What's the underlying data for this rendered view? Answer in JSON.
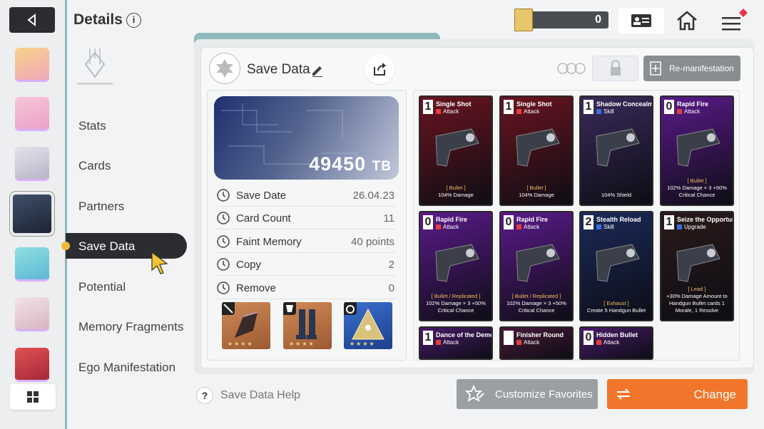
{
  "header": {
    "title": "Details",
    "currency_value": "0"
  },
  "nav": {
    "items": [
      "Stats",
      "Cards",
      "Partners",
      "Save Data",
      "Potential",
      "Memory Fragments",
      "Ego Manifestation"
    ],
    "active": "Save Data"
  },
  "panel": {
    "save_title": "Save Data",
    "reman_label": "Re-manifestation"
  },
  "summary": {
    "tb_value": "49450",
    "tb_unit": "TB"
  },
  "stats": [
    {
      "label": "Save Date",
      "value": "26.04.23",
      "icon": "clock-icon"
    },
    {
      "label": "Card Count",
      "value": "11",
      "icon": "card-icon"
    },
    {
      "label": "Faint Memory",
      "value": "40 points",
      "icon": "brain-icon"
    },
    {
      "label": "Copy",
      "value": "2",
      "icon": "copy-icon"
    },
    {
      "label": "Remove",
      "value": "0",
      "icon": "remove-icon"
    }
  ],
  "equipment": [
    {
      "slot": "weapon",
      "icon": "sword-icon",
      "color": "#c57a45"
    },
    {
      "slot": "armor",
      "icon": "armor-icon",
      "color": "#c57a45"
    },
    {
      "slot": "accessory",
      "icon": "ring-icon",
      "color": "#2e5bb0"
    }
  ],
  "cards": [
    {
      "cost": "1",
      "name": "Single Shot",
      "type": "Attack",
      "tag": "[ Bullet ]",
      "desc": "104% Damage",
      "bg": "#6a1420"
    },
    {
      "cost": "1",
      "name": "Single Shot",
      "type": "Attack",
      "tag": "[ Bullet ]",
      "desc": "104% Damage",
      "bg": "#6a1420"
    },
    {
      "cost": "1",
      "name": "Shadow Concealment",
      "type": "Skill",
      "tag": "",
      "desc": "104% Shield",
      "bg": "#3a2a5a"
    },
    {
      "cost": "0",
      "name": "Rapid Fire",
      "type": "Attack",
      "tag": "[ Bullet ]",
      "desc": "102% Damage × 3 +50% Critical Chance",
      "bg": "#5a1a8a"
    },
    {
      "cost": "0",
      "name": "Rapid Fire",
      "type": "Attack",
      "tag": "[ Bullet / Replicated ]",
      "desc": "102% Damage × 3 +50% Critical Chance",
      "bg": "#5a1a8a"
    },
    {
      "cost": "0",
      "name": "Rapid Fire",
      "type": "Attack",
      "tag": "[ Bullet / Replicated ]",
      "desc": "102% Damage × 3 +50% Critical Chance",
      "bg": "#5a1a8a"
    },
    {
      "cost": "2",
      "name": "Stealth Reload",
      "type": "Skill",
      "tag": "[ Exhaust ]",
      "desc": "Create 5 Handgun Bullet",
      "bg": "#1a2a5a"
    },
    {
      "cost": "1",
      "name": "Seize the Opportunity",
      "type": "Upgrade",
      "tag": "[ Lead ]",
      "desc": "+30% Damage Amount to Handgun Bullet cards 1 Morale, 1 Resolve",
      "bg": "#2a1a1a"
    },
    {
      "cost": "1",
      "name": "Dance of the Demon",
      "type": "Attack",
      "tag": "",
      "desc": "",
      "bg": "#4a1a6a"
    },
    {
      "cost": "",
      "name": "Finisher Round",
      "type": "Attack",
      "tag": "",
      "desc": "",
      "bg": "#4a1a3a"
    },
    {
      "cost": "0",
      "name": "Hidden Bullet",
      "type": "Attack",
      "tag": "",
      "desc": "",
      "bg": "#4a1a6a"
    }
  ],
  "footer": {
    "help": "Save Data Help",
    "favorites": "Customize Favorites",
    "change": "Change"
  },
  "colors": {
    "accent_teal": "#8fb9bd",
    "change_orange": "#f1762b",
    "nav_active": "#2b2d31"
  }
}
